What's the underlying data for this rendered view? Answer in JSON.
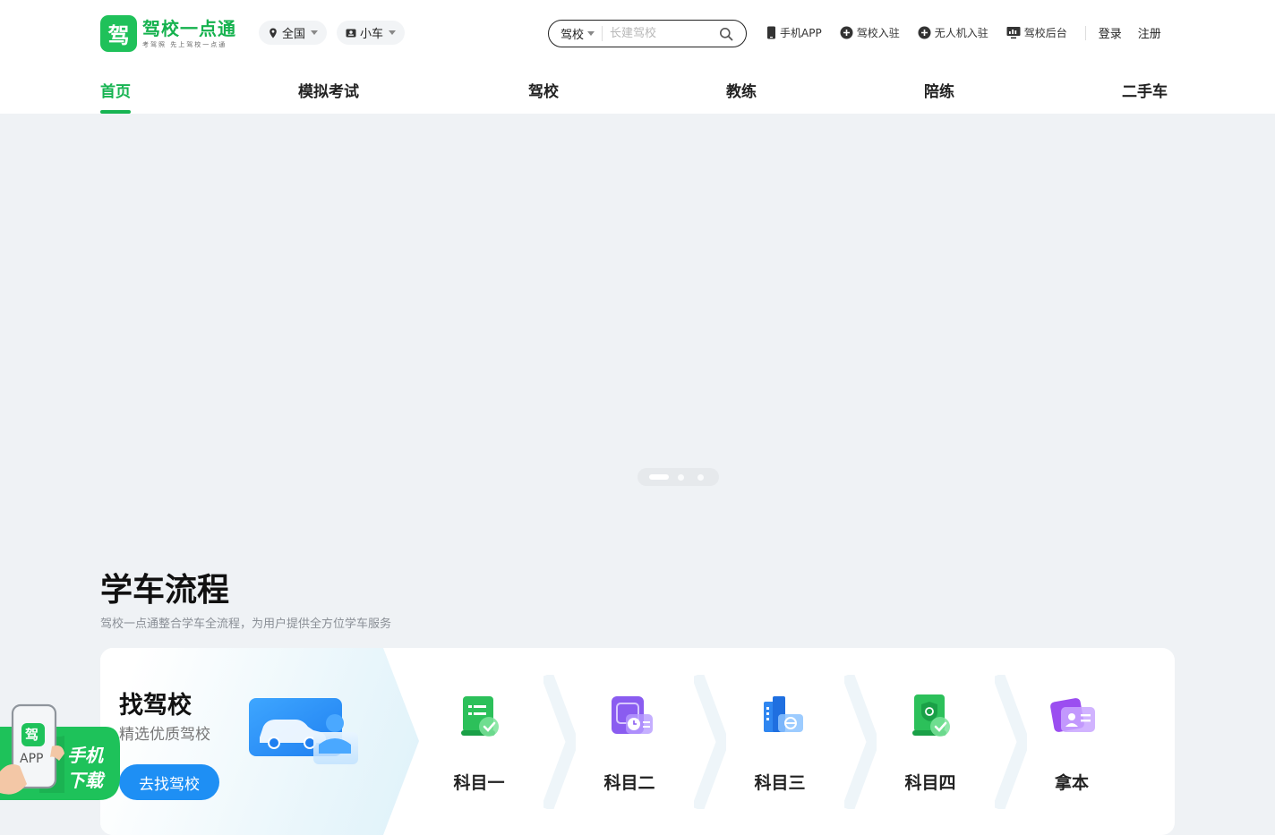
{
  "logo": {
    "mark": "驾",
    "title": "驾校一点通",
    "slogan": "考驾照 先上驾校一点通"
  },
  "region": {
    "label": "全国",
    "icon": "location-pin-icon"
  },
  "car_type": {
    "label": "小车",
    "icon": "car-id-icon"
  },
  "search": {
    "type": "驾校",
    "placeholder": "长建驾校",
    "icon": "search-icon"
  },
  "toplinks": [
    {
      "label": "手机APP",
      "icon": "phone-icon"
    },
    {
      "label": "驾校入驻",
      "icon": "plus-circle-icon"
    },
    {
      "label": "无人机入驻",
      "icon": "plus-circle-icon"
    },
    {
      "label": "驾校后台",
      "icon": "chart-icon"
    }
  ],
  "auth": {
    "login": "登录",
    "register": "注册"
  },
  "nav": [
    {
      "label": "首页",
      "active": true
    },
    {
      "label": "模拟考试"
    },
    {
      "label": "驾校"
    },
    {
      "label": "教练"
    },
    {
      "label": "陪练"
    },
    {
      "label": "二手车"
    }
  ],
  "banner": {
    "slides": 3,
    "current": 1
  },
  "process": {
    "title": "学车流程",
    "subtitle": "驾校一点通整合学车全流程，为用户提供全方位学车服务",
    "find": {
      "title": "找驾校",
      "subtitle": "精选优质驾校",
      "button": "去找驾校"
    },
    "steps": [
      {
        "label": "科目一",
        "icon": "exam-list-icon",
        "color": "#2cc05a"
      },
      {
        "label": "科目二",
        "icon": "timer-card-icon",
        "color": "#8a5cf0"
      },
      {
        "label": "科目三",
        "icon": "city-road-icon",
        "color": "#2f86f0"
      },
      {
        "label": "科目四",
        "icon": "shield-check-icon",
        "color": "#2cc05a"
      },
      {
        "label": "拿本",
        "icon": "license-card-icon",
        "color": "#9b4ef0"
      }
    ]
  },
  "app_float": {
    "badge": "APP",
    "line1": "手机",
    "line2": "下载"
  },
  "colors": {
    "brand_green": "#17b452",
    "button_blue": "#1e8ff4",
    "page_bg": "#eff2f5"
  }
}
